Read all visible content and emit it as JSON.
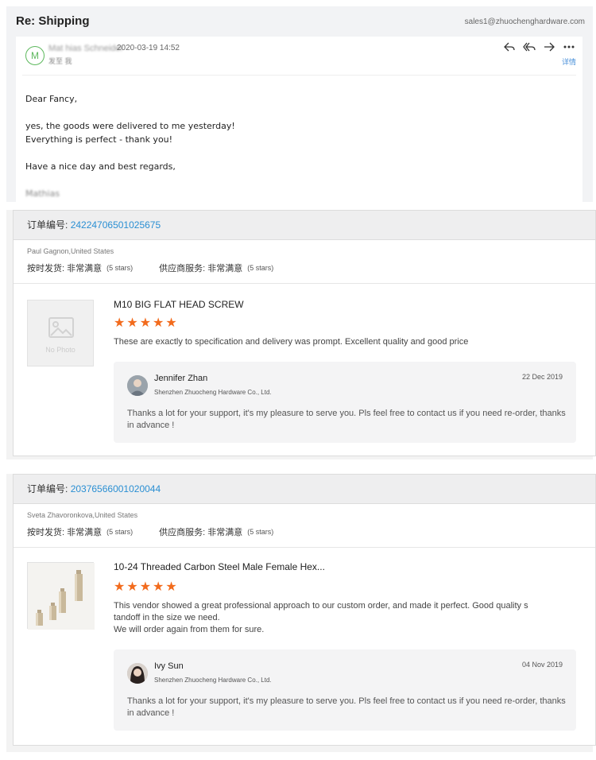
{
  "email": {
    "subject": "Re: Shipping",
    "address": "sales1@zhuochenghardware.com",
    "avatar_letter": "M",
    "sender_name": "Mat hias Schneider",
    "datetime": "2020-03-19 14:52",
    "to_line": "发至 我",
    "details_link": "详情",
    "body": {
      "greeting": "Dear Fancy,",
      "line1": "yes, the goods were delivered to me yesterday!",
      "line2": "Everything is perfect - thank you!",
      "line3": "Have a nice day and best regards,",
      "signature": "Mathias"
    }
  },
  "reviews": [
    {
      "order_label": "订单编号:",
      "order_number": "24224706501025675",
      "buyer": "Paul Gagnon,United States",
      "ship_label": "按时发货:",
      "ship_value": "非常满意",
      "ship_stars": "(5 stars)",
      "service_label": "供应商服务:",
      "service_value": "非常满意",
      "service_stars": "(5 stars)",
      "thumb_text": "No Photo",
      "product": "M10 BIG FLAT HEAD SCREW",
      "rating": 5,
      "comment": "These are exactly to specification and delivery was prompt.  Excellent quality and good price",
      "reply": {
        "name": "Jennifer Zhan",
        "company": "Shenzhen Zhuocheng Hardware Co., Ltd.",
        "date": "22 Dec 2019",
        "text": "Thanks a lot for your support, it's my pleasure to serve you. Pls feel free to contact us if you need re-order, thanks in advance !"
      }
    },
    {
      "order_label": "订单编号:",
      "order_number": "20376566001020044",
      "buyer": "Sveta Zhavoronkova,United States",
      "ship_label": "按时发货:",
      "ship_value": "非常满意",
      "ship_stars": "(5 stars)",
      "service_label": "供应商服务:",
      "service_value": "非常满意",
      "service_stars": "(5 stars)",
      "product": "10-24 Threaded Carbon Steel Male Female Hex...",
      "rating": 5,
      "comment_line1": "This vendor showed a great professional approach to our custom order, and made it perfect. Good quality s",
      "comment_line2": "tandoff in the size we need.",
      "comment_line3": "We will order again from them for sure.",
      "reply": {
        "name": "Ivy Sun",
        "company": "Shenzhen Zhuocheng Hardware Co., Ltd.",
        "date": "04 Nov 2019",
        "text": "Thanks a lot for your support, it's my pleasure to serve you. Pls feel free to contact us if you need re-order, thanks in advance !"
      }
    }
  ],
  "colors": {
    "accent": "#2a8fd3",
    "star": "#f26b1d",
    "avatar_border": "#5cb85c"
  },
  "icons": [
    "reply-icon",
    "reply-all-icon",
    "forward-icon",
    "more-icon",
    "image-placeholder-icon"
  ]
}
